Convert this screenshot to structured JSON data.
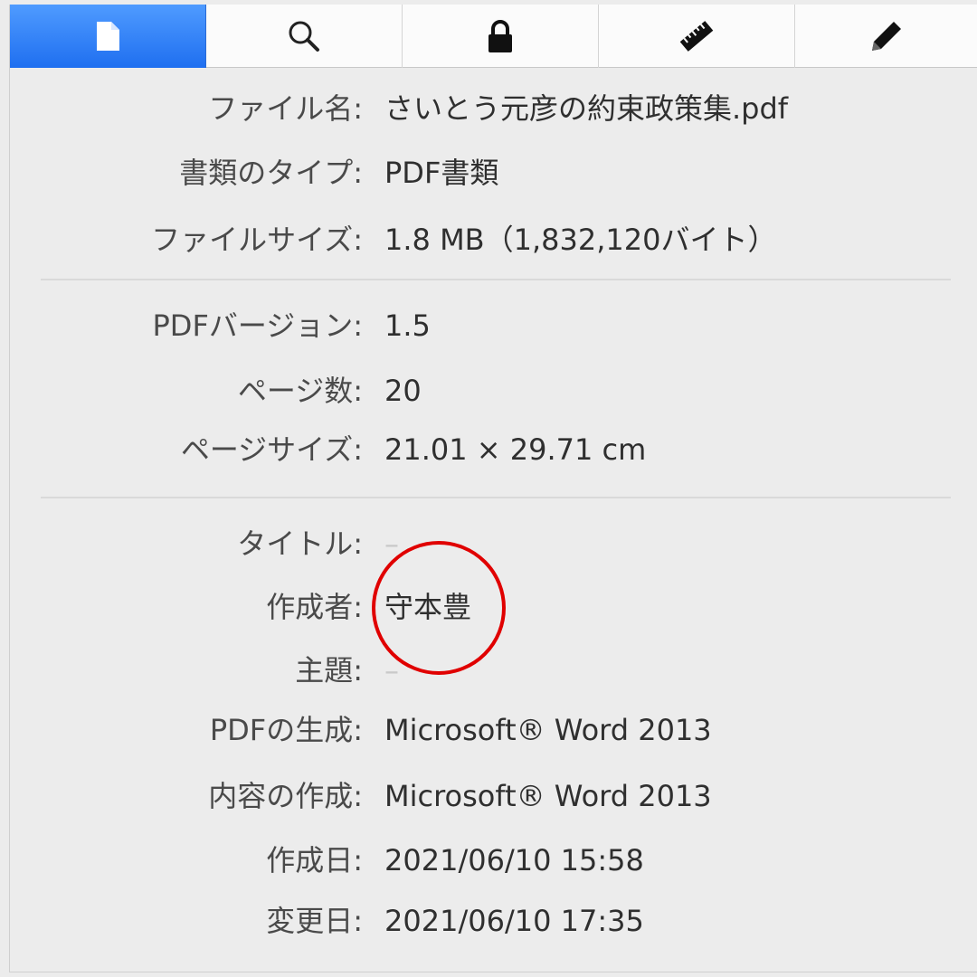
{
  "toolbar": {
    "tabs": [
      {
        "icon": "document-icon",
        "active": true
      },
      {
        "icon": "search-icon",
        "active": false
      },
      {
        "icon": "lock-icon",
        "active": false
      },
      {
        "icon": "ruler-icon",
        "active": false
      },
      {
        "icon": "pencil-icon",
        "active": false
      }
    ],
    "active_color": "#2f80ff"
  },
  "file_info": {
    "file_name": {
      "label": "ファイル名:",
      "value": "さいとう元彦の約束政策集.pdf"
    },
    "doc_type": {
      "label": "書類のタイプ:",
      "value": "PDF書類"
    },
    "file_size": {
      "label": "ファイルサイズ:",
      "value": "1.8 MB（1,832,120バイト）"
    }
  },
  "pdf_info": {
    "pdf_version": {
      "label": "PDFバージョン:",
      "value": "1.5"
    },
    "page_count": {
      "label": "ページ数:",
      "value": "20"
    },
    "page_size": {
      "label": "ページサイズ:",
      "value": "21.01 × 29.71 cm"
    }
  },
  "metadata": {
    "title": {
      "label": "タイトル:",
      "value": "–"
    },
    "author": {
      "label": "作成者:",
      "value": "守本豊"
    },
    "subject": {
      "label": "主題:",
      "value": "–"
    },
    "producer": {
      "label": "PDFの生成:",
      "value": "Microsoft® Word 2013"
    },
    "creator": {
      "label": "内容の作成:",
      "value": "Microsoft® Word 2013"
    },
    "created": {
      "label": "作成日:",
      "value": "2021/06/10 15:58"
    },
    "modified": {
      "label": "変更日:",
      "value": "2021/06/10 17:35"
    }
  },
  "annotation": {
    "type": "circle",
    "color": "#e00000",
    "target": "author"
  }
}
